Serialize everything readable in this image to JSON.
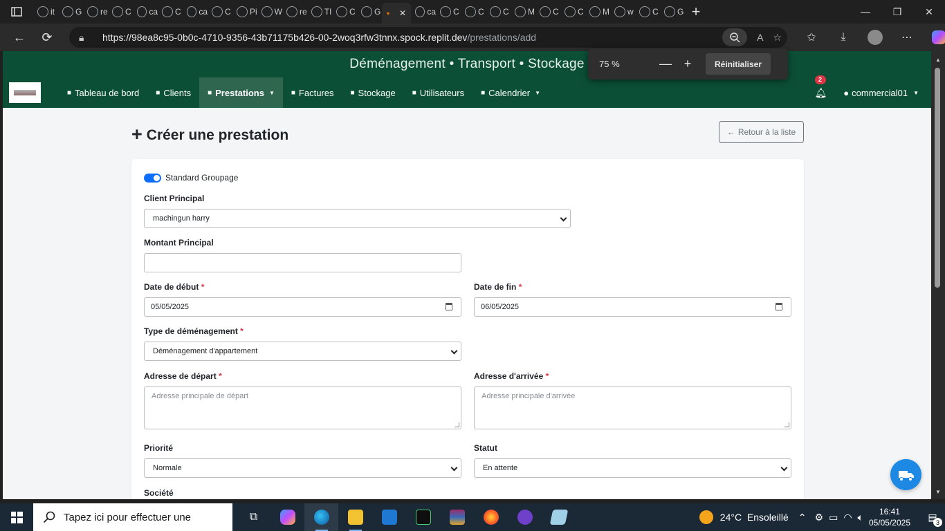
{
  "browser": {
    "tab_labels": [
      "it",
      "G",
      "re",
      "C",
      "ca",
      "C",
      "ca",
      "C",
      "Pi",
      "W",
      "re",
      "Tl",
      "C",
      "G",
      "ca",
      "C",
      "C",
      "C",
      "M",
      "C",
      "C",
      "M",
      "w",
      "C",
      "G"
    ],
    "url_host": "https://98ea8c95-0b0c-4710-9356-43b71175b426-00-2woq3rfw3tnnx.spock.replit.dev",
    "url_path": "/prestations/add",
    "zoom_popup": {
      "value": "75 %",
      "minus": "—",
      "plus": "+",
      "reset_label": "Réinitialiser"
    }
  },
  "app": {
    "brand_title": "Déménagement • Transport • Stockage",
    "nav": [
      {
        "label": "Tableau de bord",
        "icon": "dashboard-icon"
      },
      {
        "label": "Clients",
        "icon": "users-icon"
      },
      {
        "label": "Prestations",
        "icon": "truck-icon",
        "active": true,
        "dropdown": true
      },
      {
        "label": "Factures",
        "icon": "invoice-icon"
      },
      {
        "label": "Stockage",
        "icon": "warehouse-icon"
      },
      {
        "label": "Utilisateurs",
        "icon": "users-cog-icon"
      },
      {
        "label": "Calendrier",
        "icon": "calendar-icon",
        "dropdown": true
      }
    ],
    "notification_count": "2",
    "user_name": "commercial01"
  },
  "page": {
    "title": "Créer une prestation",
    "back_button": "Retour à la liste",
    "form": {
      "switch_label": "Standard Groupage",
      "switch_on": true,
      "client_label": "Client Principal",
      "client_value": "machingun harry",
      "amount_label": "Montant Principal",
      "amount_value": "",
      "start_date_label": "Date de début",
      "start_date_value": "05/05/2025",
      "end_date_label": "Date de fin",
      "end_date_value": "06/05/2025",
      "type_label": "Type de déménagement",
      "type_value": "Déménagement d'appartement",
      "departure_label": "Adresse de départ",
      "departure_placeholder": "Adresse principale de départ",
      "arrival_label": "Adresse d'arrivée",
      "arrival_placeholder": "Adresse principale d'arrivée",
      "priority_label": "Priorité",
      "priority_value": "Normale",
      "status_label": "Statut",
      "status_value": "En attente",
      "company_label": "Société",
      "required_mark": "*"
    }
  },
  "taskbar": {
    "search_placeholder": "Tapez ici pour effectuer une",
    "weather": "24°C  Ensoleillé",
    "time": "16:41",
    "date": "05/05/2025",
    "notif_count": "3"
  },
  "colors": {
    "app_green": "#0b4f36",
    "nav_active": "#2f6650",
    "primary": "#0d6efd",
    "danger": "#dc3545",
    "fab": "#1e88e5"
  }
}
